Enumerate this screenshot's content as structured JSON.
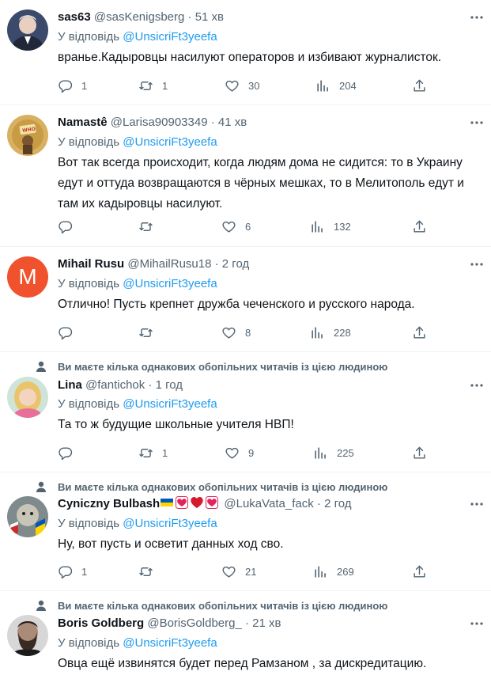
{
  "reply_prefix": "У відповідь",
  "social_context": "Ви маєте кілька однакових обопільних читачів із цією людиною",
  "colors": {
    "accent": "#1d9bf0",
    "muted": "#536471",
    "text": "#0f1419"
  },
  "tweets": [
    {
      "name": "sas63",
      "handle": "@sasKenigsberg",
      "time": "51 хв",
      "mention": "@UnsicriFt3yeefa",
      "text": "вранье.Кадыровцы насилуют операторов и избивают журналисток.",
      "replies": "1",
      "retweets": "1",
      "likes": "30",
      "views": "204"
    },
    {
      "name": "Namastê",
      "handle": "@Larisa90903349",
      "time": "41 хв",
      "mention": "@UnsicriFt3yeefa",
      "text": "Вот так всегда происходит, когда людям дома не сидится: то в Украину едут и оттуда возвращаются в чёрных мешках, то в Мелитополь едут и там их кадыровцы насилуют.",
      "replies": "",
      "retweets": "",
      "likes": "6",
      "views": "132"
    },
    {
      "name": "Mihail Rusu",
      "handle": "@MihailRusu18",
      "time": "2 год",
      "mention": "@UnsicriFt3yeefa",
      "avatar_letter": "M",
      "text": "Отлично! Пусть крепнет дружба чеченского и русского народа.",
      "replies": "",
      "retweets": "",
      "likes": "8",
      "views": "228"
    },
    {
      "name": "Lina",
      "handle": "@fantichok",
      "time": "1 год",
      "mention": "@UnsicriFt3yeefa",
      "text": "Та то ж будущие школьные учителя НВП!",
      "replies": "",
      "retweets": "1",
      "likes": "9",
      "views": "225"
    },
    {
      "name": "Cyniczny Bulbash",
      "handle": "@LukaVata_fack",
      "time": "2 год",
      "mention": "@UnsicriFt3yeefa",
      "text": "Ну, вот пусть и осветит данных ход сво.",
      "replies": "1",
      "retweets": "",
      "likes": "21",
      "views": "269"
    },
    {
      "name": "Boris Goldberg",
      "handle": "@BorisGoldberg_",
      "time": "21 хв",
      "mention": "@UnsicriFt3yeefa",
      "text": "Овца ещё извинятся будет перед Рамзаном , за дискредитацию."
    }
  ]
}
